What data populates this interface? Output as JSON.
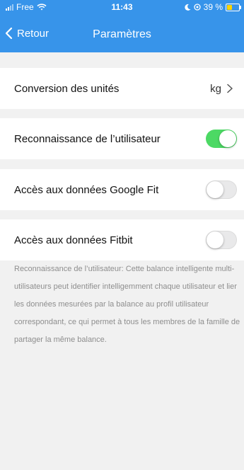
{
  "status_bar": {
    "carrier": "Free",
    "time": "11:43",
    "battery_text": "39 %",
    "icons": [
      "signal-icon",
      "wifi-icon",
      "moon-icon",
      "location-icon",
      "battery-icon"
    ]
  },
  "nav": {
    "back_label": "Retour",
    "title": "Paramètres"
  },
  "settings": {
    "unit_conversion": {
      "label": "Conversion des unités",
      "value": "kg"
    },
    "user_recognition": {
      "label": "Reconnaissance de l’utilisateur",
      "enabled": true
    },
    "google_fit": {
      "label": "Accès aux données Google Fit",
      "enabled": false
    },
    "fitbit": {
      "label": "Accès aux données Fitbit",
      "enabled": false
    }
  },
  "description": "Reconnaissance de l’utilisateur:  Cette balance intelligente multi-utilisateurs peut identifier intelligemment chaque utilisateur et lier les données mesurées par la balance au profil utilisateur correspondant, ce qui permet à tous les membres de la famille de partager la même balance.",
  "colors": {
    "header": "#3794ea",
    "toggle_on": "#4cd964",
    "background": "#f1f1f1",
    "battery": "#ffd400"
  }
}
